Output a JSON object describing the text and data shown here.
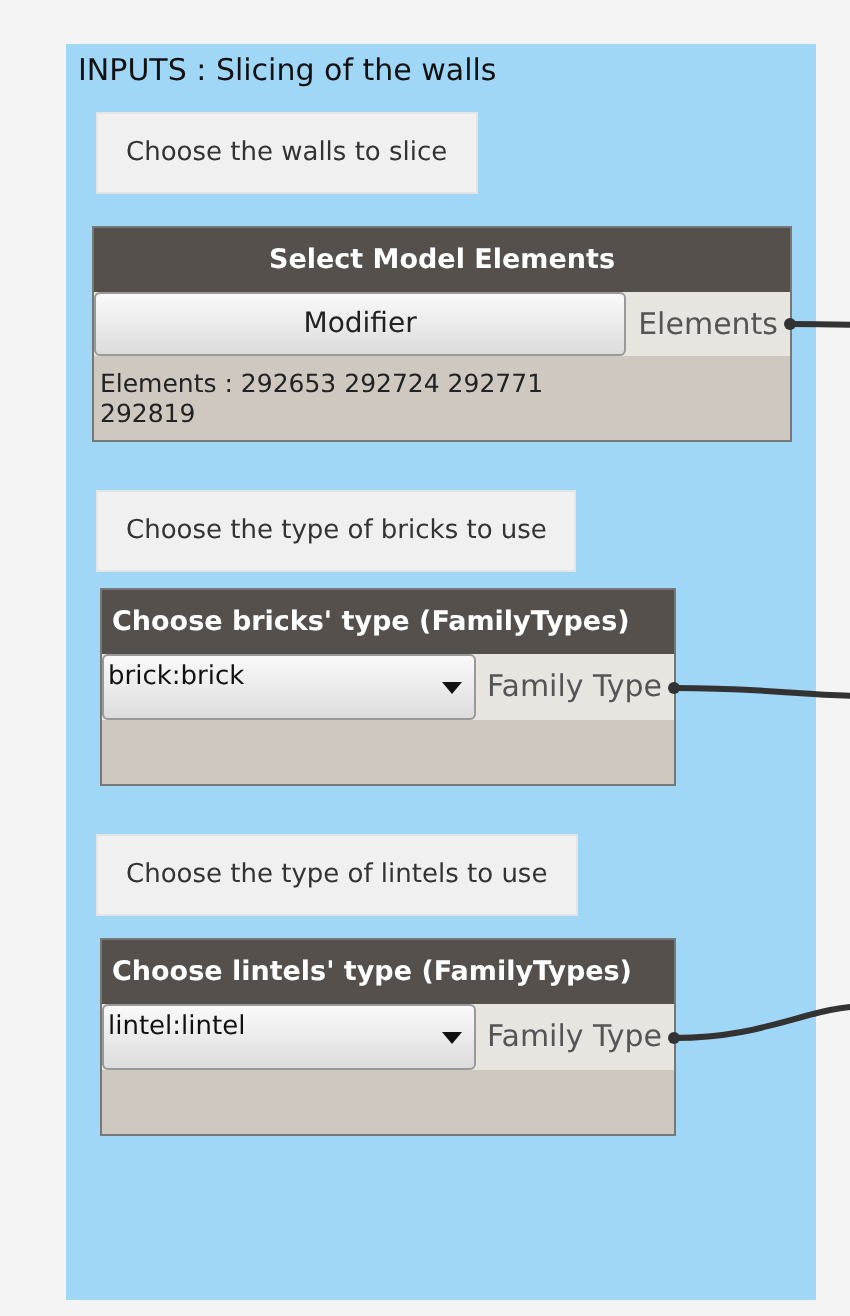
{
  "group": {
    "title": "INPUTS : Slicing of the walls",
    "items": [
      {
        "kind": "note",
        "text": "Choose the walls to slice"
      },
      {
        "kind": "select",
        "title": "Select Model Elements",
        "button": "Modifier",
        "output": "Elements",
        "info": "Elements : 292653 292724 292771 292819"
      },
      {
        "kind": "note",
        "text": "Choose the type of bricks to use"
      },
      {
        "kind": "dropdown",
        "title": "Choose bricks' type (FamilyTypes)",
        "value": "brick:brick",
        "output": "Family Type"
      },
      {
        "kind": "note",
        "text": "Choose the type of lintels to use"
      },
      {
        "kind": "dropdown",
        "title": "Choose lintels' type (FamilyTypes)",
        "value": "lintel:lintel",
        "output": "Family Type"
      }
    ]
  }
}
